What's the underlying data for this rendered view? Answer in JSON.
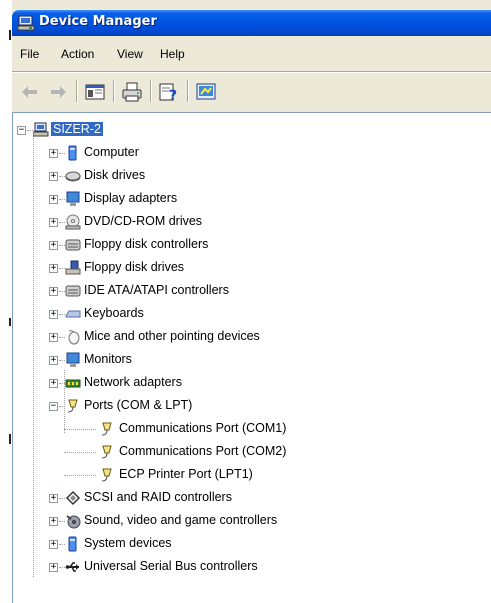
{
  "window": {
    "title": "Device Manager",
    "title_icon": "device-manager-icon",
    "colors": {
      "titlebar": "#0054e3",
      "selection": "#316ac5",
      "chrome": "#ece9d8"
    }
  },
  "menu": {
    "items": [
      {
        "label": "File"
      },
      {
        "label": "Action"
      },
      {
        "label": "View"
      },
      {
        "label": "Help"
      }
    ]
  },
  "toolbar": {
    "buttons": [
      {
        "icon": "back-arrow-icon"
      },
      {
        "icon": "forward-arrow-icon"
      },
      {
        "icon": "show-hide-console-tree-icon"
      },
      {
        "icon": "print-icon"
      },
      {
        "icon": "help-icon"
      },
      {
        "icon": "properties-icon"
      }
    ]
  },
  "tree": {
    "root": {
      "label": "SIZER-2",
      "expanded": true,
      "selected": true,
      "icon": "computer-icon"
    },
    "nodes": [
      {
        "label": "Computer",
        "icon": "computer-icon",
        "expanded": false,
        "level": 1
      },
      {
        "label": "Disk drives",
        "icon": "disk-drive-icon",
        "expanded": false,
        "level": 1
      },
      {
        "label": "Display adapters",
        "icon": "display-adapter-icon",
        "expanded": false,
        "level": 1
      },
      {
        "label": "DVD/CD-ROM drives",
        "icon": "dvd-drive-icon",
        "expanded": false,
        "level": 1
      },
      {
        "label": "Floppy disk controllers",
        "icon": "floppy-controller-icon",
        "expanded": false,
        "level": 1
      },
      {
        "label": "Floppy disk drives",
        "icon": "floppy-drive-icon",
        "expanded": false,
        "level": 1
      },
      {
        "label": "IDE ATA/ATAPI controllers",
        "icon": "ide-controller-icon",
        "expanded": false,
        "level": 1
      },
      {
        "label": "Keyboards",
        "icon": "keyboard-icon",
        "expanded": false,
        "level": 1
      },
      {
        "label": "Mice and other pointing devices",
        "icon": "mouse-icon",
        "expanded": false,
        "level": 1
      },
      {
        "label": "Monitors",
        "icon": "monitor-icon",
        "expanded": false,
        "level": 1
      },
      {
        "label": "Network adapters",
        "icon": "network-adapter-icon",
        "expanded": false,
        "level": 1
      },
      {
        "label": "Ports (COM & LPT)",
        "icon": "port-icon",
        "expanded": true,
        "level": 1
      },
      {
        "label": "Communications Port (COM1)",
        "icon": "port-icon",
        "level": 2
      },
      {
        "label": "Communications Port (COM2)",
        "icon": "port-icon",
        "level": 2
      },
      {
        "label": "ECP Printer Port (LPT1)",
        "icon": "port-icon",
        "level": 2
      },
      {
        "label": "SCSI and RAID controllers",
        "icon": "scsi-controller-icon",
        "expanded": false,
        "level": 1
      },
      {
        "label": "Sound, video and game controllers",
        "icon": "sound-icon",
        "expanded": false,
        "level": 1
      },
      {
        "label": "System devices",
        "icon": "system-device-icon",
        "expanded": false,
        "level": 1
      },
      {
        "label": "Universal Serial Bus controllers",
        "icon": "usb-icon",
        "expanded": false,
        "level": 1
      }
    ]
  }
}
